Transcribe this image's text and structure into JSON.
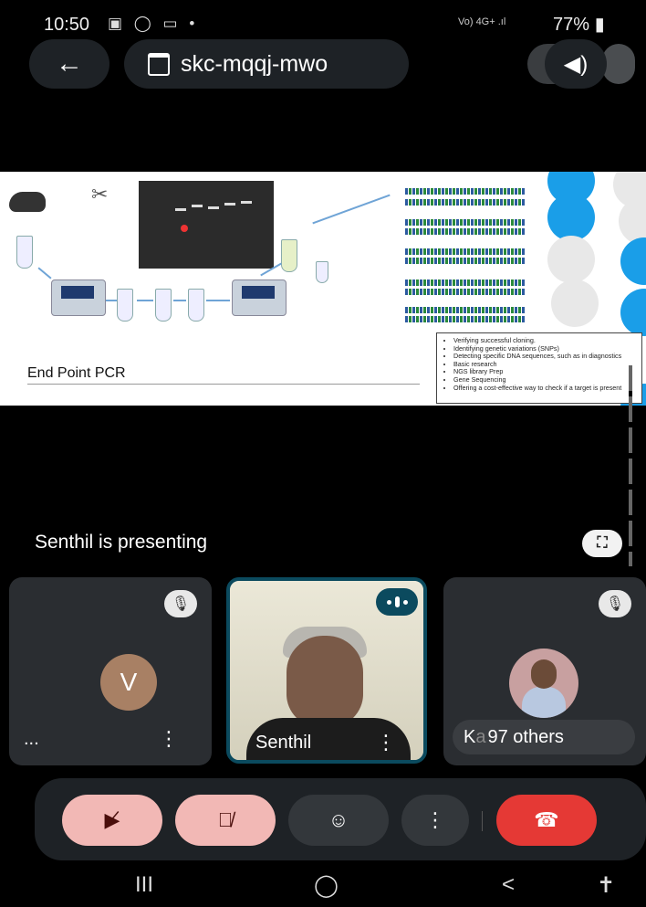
{
  "status_bar": {
    "time": "10:50",
    "left_icons": "▣ ◯ ▭ •",
    "network": "Vo) 4G+ .ıl",
    "battery": "77%"
  },
  "top_bar": {
    "meeting_code": "skc-mqqj-mwo",
    "back_icon": "←",
    "speaker_icon": "◀)"
  },
  "slide": {
    "caption": "End Point PCR",
    "bullets": [
      "Verifying successful cloning.",
      "Identifying genetic variations (SNPs)",
      "Detecting specific DNA sequences, such as in diagnostics",
      "Basic research",
      "NGS library Prep",
      "Gene Sequencing",
      "Offering a cost-effective way to check if a target is present"
    ]
  },
  "presenting": {
    "label": "Senthil is presenting"
  },
  "tiles": {
    "left": {
      "avatar_letter": "V",
      "name": "..."
    },
    "middle": {
      "name": "Senthil"
    },
    "right": {
      "name_fragment": "K",
      "ghost": "a",
      "others_label": "97 others"
    }
  },
  "controls": {
    "camera_label": "camera-off",
    "mic_label": "mic-off",
    "emoji": "☺",
    "more": "⋮",
    "end_call": "end-call"
  },
  "nav": {
    "recents": "III",
    "home": "◯",
    "back": "<",
    "accessibility": "🯅"
  },
  "colors": {
    "accent_teal": "#0b4a5e",
    "muted_pink": "#f2b8b5",
    "end_red": "#e53935",
    "surface": "#1e2226"
  }
}
